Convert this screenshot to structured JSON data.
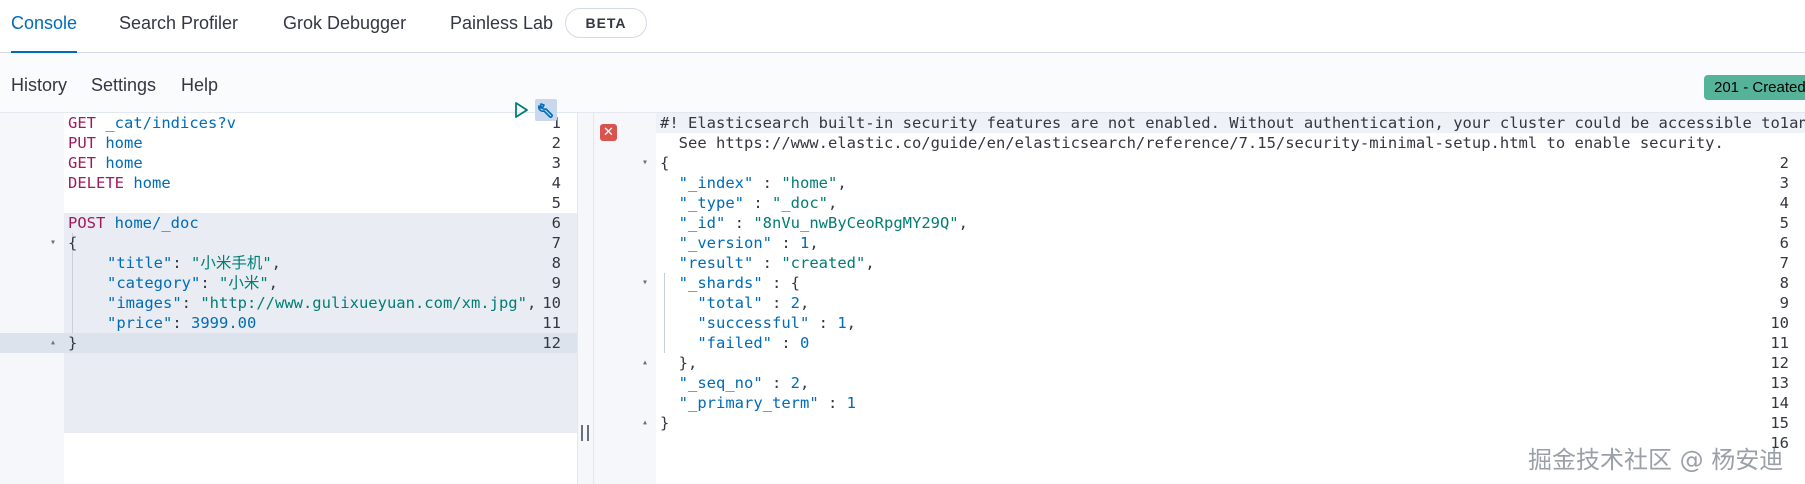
{
  "tabs": [
    {
      "label": "Console"
    },
    {
      "label": "Search Profiler"
    },
    {
      "label": "Grok Debugger"
    },
    {
      "label": "Painless Lab"
    }
  ],
  "beta_badge": "BETA",
  "menu": {
    "history": "History",
    "settings": "Settings",
    "help": "Help"
  },
  "status_badge": "201 - Created",
  "request_editor": {
    "line_numbers": [
      "1",
      "2",
      "3",
      "4",
      "5",
      "6",
      "7",
      "8",
      "9",
      "10",
      "11",
      "12"
    ],
    "lines": [
      {
        "method": "GET",
        "path": " _cat/indices?v"
      },
      {
        "method": "PUT",
        "path": " home"
      },
      {
        "method": "GET",
        "path": " home"
      },
      {
        "method": "DELETE",
        "path": " home"
      },
      {
        "text": ""
      },
      {
        "method": "POST",
        "path": " home/_doc"
      },
      {
        "text": "{"
      },
      {
        "key": "\"title\"",
        "sep": ": ",
        "value": "\"小米手机\"",
        "end": ","
      },
      {
        "key": "\"category\"",
        "sep": ": ",
        "value": "\"小米\"",
        "end": ","
      },
      {
        "key": "\"images\"",
        "sep": ": ",
        "value": "\"http://www.gulixueyuan.com/xm.jpg\"",
        "end": ","
      },
      {
        "key": "\"price\"",
        "sep": ": ",
        "value": "3999.00",
        "end": ""
      },
      {
        "text": "}"
      }
    ]
  },
  "response_editor": {
    "line_numbers": [
      "1",
      "",
      "2",
      "3",
      "4",
      "5",
      "6",
      "7",
      "8",
      "9",
      "10",
      "11",
      "12",
      "13",
      "14",
      "15",
      "16"
    ],
    "warning_line_1": "#! Elasticsearch built-in security features are not enabled. Without authentication, your cluster could be accessible to anyone.",
    "warning_line_2": "  See https://www.elastic.co/guide/en/elasticsearch/reference/7.15/security-minimal-setup.html to enable security.",
    "lines": [
      {
        "text": "{"
      },
      {
        "indent": "  ",
        "key": "\"_index\"",
        "sep": " : ",
        "value": "\"home\"",
        "end": ","
      },
      {
        "indent": "  ",
        "key": "\"_type\"",
        "sep": " : ",
        "value": "\"_doc\"",
        "end": ","
      },
      {
        "indent": "  ",
        "key": "\"_id\"",
        "sep": " : ",
        "value": "\"8nVu_nwByCeoRpgMY29Q\"",
        "end": ","
      },
      {
        "indent": "  ",
        "key": "\"_version\"",
        "sep": " : ",
        "value": "1",
        "end": ","
      },
      {
        "indent": "  ",
        "key": "\"result\"",
        "sep": " : ",
        "value": "\"created\"",
        "end": ","
      },
      {
        "indent": "  ",
        "key": "\"_shards\"",
        "sep": " : ",
        "value": "{",
        "end": ""
      },
      {
        "indent": "    ",
        "key": "\"total\"",
        "sep": " : ",
        "value": "2",
        "end": ","
      },
      {
        "indent": "    ",
        "key": "\"successful\"",
        "sep": " : ",
        "value": "1",
        "end": ","
      },
      {
        "indent": "    ",
        "key": "\"failed\"",
        "sep": " : ",
        "value": "0",
        "end": ""
      },
      {
        "text": "  },"
      },
      {
        "indent": "  ",
        "key": "\"_seq_no\"",
        "sep": " : ",
        "value": "2",
        "end": ","
      },
      {
        "indent": "  ",
        "key": "\"_primary_term\"",
        "sep": " : ",
        "value": "1",
        "end": ""
      },
      {
        "text": "}"
      },
      {
        "text": ""
      }
    ]
  },
  "watermark": "掘金技术社区 @ 杨安迪",
  "colors": {
    "accent": "#006bb8",
    "method": "#a3195b",
    "string": "#017d73",
    "status_success": "#54b399",
    "error": "#d9534f"
  },
  "icons": [
    "play-icon",
    "wrench-icon",
    "error-icon",
    "fold-arrow-icon",
    "resize-handle-icon"
  ]
}
